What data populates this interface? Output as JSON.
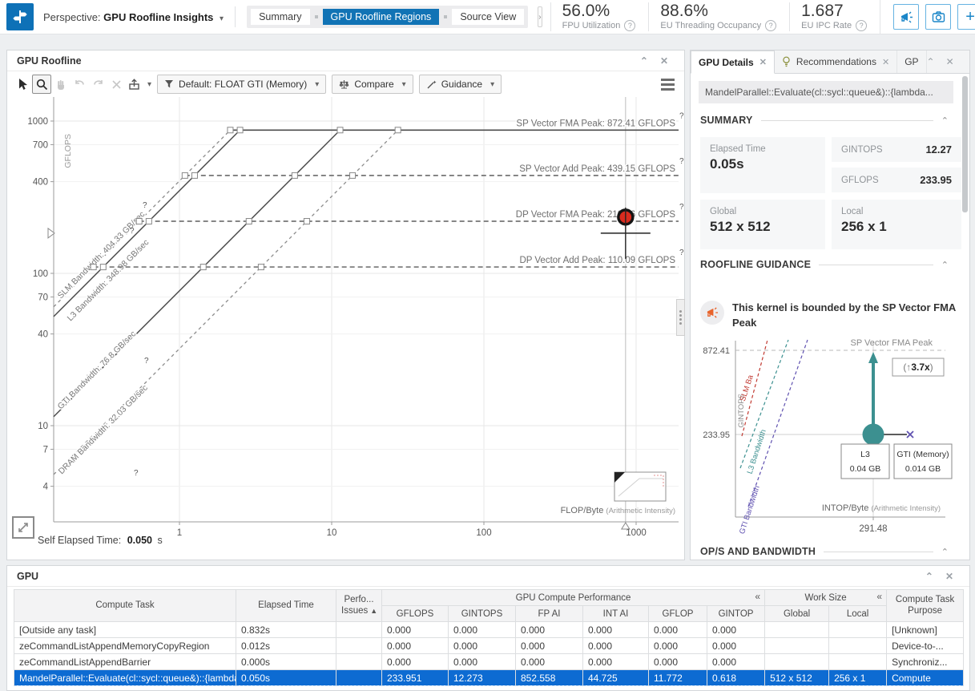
{
  "colors": {
    "accent_blue": "#1173b5",
    "selection_blue": "#0d6bd2",
    "point_red": "#d92b1e",
    "teal": "#3c9090",
    "purple": "#5f51b0",
    "orange": "#e8642c"
  },
  "header": {
    "perspective_label": "Perspective:",
    "perspective_value": "GPU Roofline Insights",
    "view_tabs": [
      {
        "label": "Summary",
        "active": false
      },
      {
        "label": "GPU Roofline Regions",
        "active": true
      },
      {
        "label": "Source View",
        "active": false
      }
    ],
    "expand_arrow": "›",
    "metrics": [
      {
        "value": "56.0%",
        "label": "FPU Utilization"
      },
      {
        "value": "88.6%",
        "label": "EU Threading Occupancy"
      },
      {
        "value": "1.687",
        "label": "EU IPC Rate"
      }
    ]
  },
  "roofline_panel": {
    "title": "GPU Roofline",
    "toolbar": {
      "filter_label": "Default: FLOAT GTI (Memory)",
      "compare_label": "Compare",
      "guidance_label": "Guidance"
    },
    "footer": {
      "label": "Self Elapsed Time:",
      "value": "0.050",
      "unit": "s"
    }
  },
  "chart_data": [
    {
      "type": "roofline",
      "xlabel": "FLOP/Byte",
      "xlabel_sub": "(Arithmetic Intensity)",
      "ylabel": "GFLOPS",
      "x_ticks": [
        1,
        10,
        100,
        1000
      ],
      "y_ticks": [
        1000,
        700,
        400,
        100,
        70,
        40,
        10,
        7,
        4
      ],
      "rooflines": [
        {
          "name": "SP Vector FMA Peak",
          "value": 872.41,
          "unit": "GFLOPS",
          "style": "solid"
        },
        {
          "name": "SP Vector Add Peak",
          "value": 439.15,
          "unit": "GFLOPS",
          "style": "dashed"
        },
        {
          "name": "DP Vector FMA Peak",
          "value": 219.76,
          "unit": "GFLOPS",
          "style": "dashed"
        },
        {
          "name": "DP Vector Add Peak",
          "value": 110.09,
          "unit": "GFLOPS",
          "style": "dashed"
        }
      ],
      "bandwidth_lines": [
        {
          "name": "SLM Bandwidth",
          "value": 404.33,
          "unit": "GB/sec",
          "style": "dashed"
        },
        {
          "name": "L3 Bandwidth",
          "value": 348.98,
          "unit": "GB/sec",
          "style": "solid"
        },
        {
          "name": "GTI Bandwidth",
          "value": 76.8,
          "unit": "GB/sec",
          "style": "solid"
        },
        {
          "name": "DRAM Bandwidth",
          "value": 32.03,
          "unit": "GB/sec",
          "style": "dashed"
        }
      ],
      "points": [
        {
          "ai": 852.558,
          "gflops": 233.951,
          "color": "#d92b1e",
          "selected": true
        }
      ]
    },
    {
      "type": "roofline-guidance",
      "ylabel": "GINTOPS",
      "xlabel": "INTOP/Byte",
      "xlabel_sub": "(Arithmetic Intensity)",
      "peak": {
        "label": "SP Vector FMA Peak",
        "value": "872.41"
      },
      "point": {
        "value": "233.95",
        "ai": "291.48"
      },
      "speedup": "3.7x",
      "memory_boxes": [
        {
          "label": "L3",
          "value": "0.04 GB"
        },
        {
          "label": "GTI (Memory)",
          "value": "0.014 GB"
        }
      ],
      "bandwidth_labels": [
        {
          "label": "SLM Ba",
          "color": "#c23b33"
        },
        {
          "label": "L3 Bandwidth",
          "color": "#3c9090"
        },
        {
          "label": "GTI Bandwidth",
          "color": "#5f51b0"
        }
      ]
    }
  ],
  "details_panel": {
    "tabs": [
      {
        "label": "GPU Details",
        "active": true,
        "icon": null,
        "closable": true
      },
      {
        "label": "Recommendations",
        "active": false,
        "icon": "bulb-icon",
        "closable": true
      },
      {
        "label": "GP",
        "active": false,
        "icon": null,
        "closable": false
      }
    ],
    "kernel_name": "MandelParallel::Evaluate(cl::sycl::queue&)::{lambda...",
    "summary_title": "SUMMARY",
    "summary": {
      "elapsed_label": "Elapsed Time",
      "elapsed_value": "0.05s",
      "gintops_label": "GINTOPS",
      "gintops_value": "12.27",
      "gflops_label": "GFLOPS",
      "gflops_value": "233.95",
      "global_label": "Global",
      "global_value": "512 x 512",
      "local_label": "Local",
      "local_value": "256 x 1"
    },
    "guidance_title": "ROOFLINE GUIDANCE",
    "guidance_message": "This kernel is bounded by the SP Vector FMA Peak",
    "ops_title": "OP/S AND BANDWIDTH"
  },
  "gpu_panel": {
    "title": "GPU",
    "table": {
      "widths": [
        277,
        125,
        57,
        83,
        84,
        84,
        82,
        73,
        72,
        80,
        72,
        96
      ],
      "lead_columns": [
        {
          "label": "Compute Task",
          "sorted": false
        },
        {
          "label": "Elapsed Time",
          "sorted": false
        },
        {
          "label": "Perfo...\nIssues",
          "sorted": true
        }
      ],
      "groups": [
        {
          "label": "GPU Compute Performance",
          "collapser": "«",
          "columns": [
            "GFLOPS",
            "GINTOPS",
            "FP AI",
            "INT AI",
            "GFLOP",
            "GINTOP"
          ]
        },
        {
          "label": "Work Size",
          "collapser": "«",
          "columns": [
            "Global",
            "Local"
          ]
        }
      ],
      "tail_columns": [
        {
          "label": "Compute Task Purpose"
        }
      ],
      "rows": [
        {
          "selected": false,
          "cells": [
            "[Outside any task]",
            "0.832s",
            "",
            "0.000",
            "0.000",
            "0.000",
            "0.000",
            "0.000",
            "0.000",
            "",
            "",
            "[Unknown]"
          ]
        },
        {
          "selected": false,
          "cells": [
            "zeCommandListAppendMemoryCopyRegion",
            "0.012s",
            "",
            "0.000",
            "0.000",
            "0.000",
            "0.000",
            "0.000",
            "0.000",
            "",
            "",
            "Device-to-..."
          ]
        },
        {
          "selected": false,
          "cells": [
            "zeCommandListAppendBarrier",
            "0.000s",
            "",
            "0.000",
            "0.000",
            "0.000",
            "0.000",
            "0.000",
            "0.000",
            "",
            "",
            "Synchroniz..."
          ]
        },
        {
          "selected": true,
          "cells": [
            "MandelParallel::Evaluate(cl::sycl::queue&)::{lambda",
            "0.050s",
            "",
            "233.951",
            "12.273",
            "852.558",
            "44.725",
            "11.772",
            "0.618",
            "512 x 512",
            "256 x 1",
            "Compute"
          ]
        }
      ]
    }
  }
}
